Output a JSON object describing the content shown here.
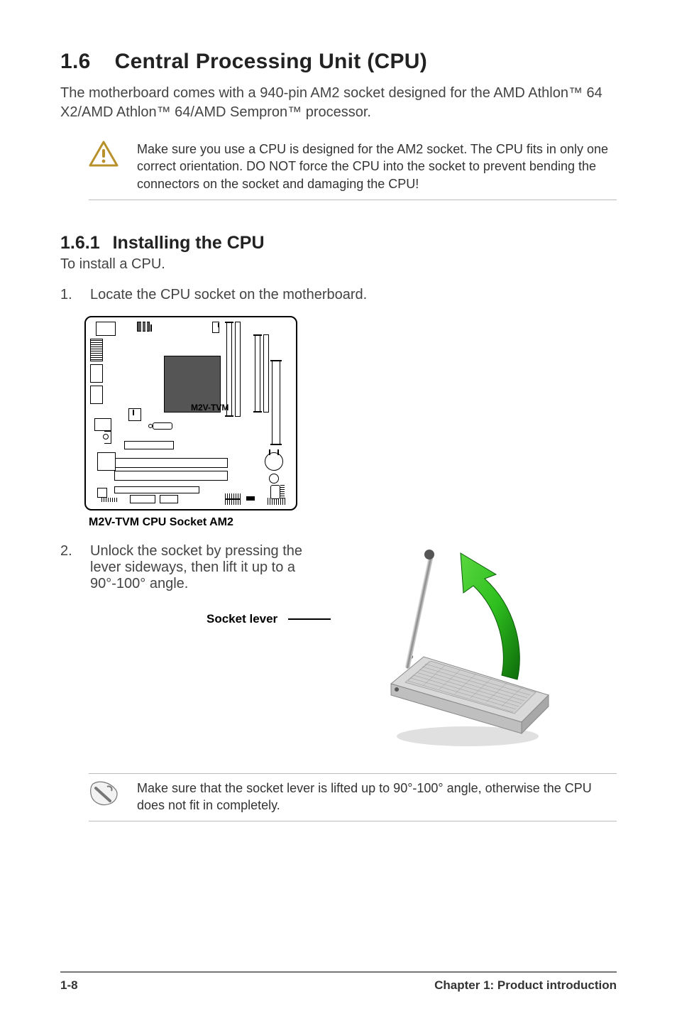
{
  "section": {
    "number": "1.6",
    "title": "Central Processing Unit (CPU)",
    "intro": "The motherboard comes with a 940-pin AM2 socket designed for the AMD Athlon™ 64 X2/AMD Athlon™ 64/AMD Sempron™ processor."
  },
  "warning_callout": {
    "icon": "caution-triangle-icon",
    "text": "Make sure you use a CPU is designed for the AM2 socket. The CPU fits in only one correct orientation. DO NOT force the CPU into the socket to prevent bending the connectors on the socket and damaging the CPU!"
  },
  "subsection": {
    "number": "1.6.1",
    "title": "Installing the CPU",
    "lead": "To install a CPU."
  },
  "steps": [
    {
      "num": "1.",
      "text": "Locate the CPU socket on the motherboard."
    },
    {
      "num": "2.",
      "text": "Unlock the socket by pressing the lever sideways, then lift it up to a 90°-100° angle."
    }
  ],
  "board_diagram": {
    "internal_label": "M2V-TVM",
    "caption": "M2V-TVM CPU Socket AM2"
  },
  "socket_figure": {
    "label": "Socket lever",
    "image_desc": "CPU socket with lever lifted, green arrow indicating upward rotation"
  },
  "note_callout": {
    "icon": "hand-note-icon",
    "text": "Make sure that the socket  lever is lifted up to 90°-100° angle, otherwise the CPU does not fit in completely."
  },
  "footer": {
    "page": "1-8",
    "chapter": "Chapter 1: Product introduction"
  },
  "colors": {
    "arrow_green": "#3fbf2f",
    "arrow_dark": "#0d6b0a"
  }
}
